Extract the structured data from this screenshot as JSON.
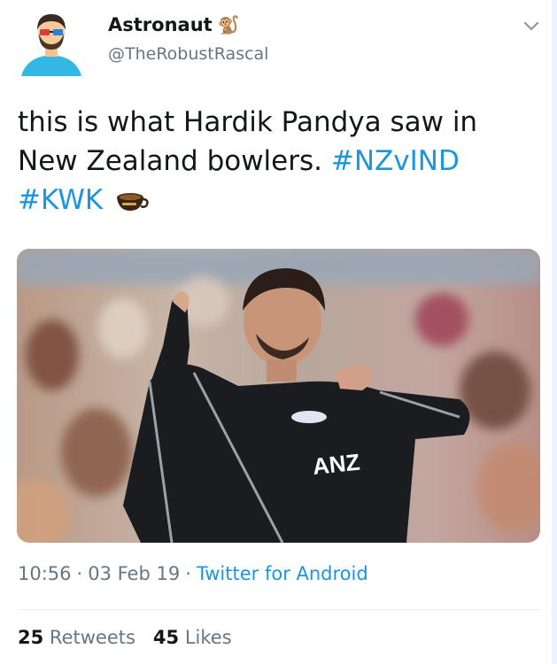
{
  "tweet": {
    "author": {
      "name": "Astronaut",
      "name_emoji": "🐒",
      "handle": "@TheRobustRascal"
    },
    "text": {
      "line1": "this is what Hardik Pandya saw in",
      "line2": "New Zealand bowlers.",
      "hashtag1": "#NZvIND",
      "hashtag2": "#KWK"
    },
    "media": {
      "jersey_text": "ANZ"
    },
    "meta": {
      "time": "10:56",
      "sep1": "·",
      "date": "03 Feb 19",
      "sep2": "·",
      "source": "Twitter for Android"
    },
    "stats": {
      "retweets_count": "25",
      "retweets_label": "Retweets",
      "likes_count": "45",
      "likes_label": "Likes"
    }
  },
  "colors": {
    "link": "#1b95e0",
    "secondary_text": "#657786",
    "primary_text": "#14171a"
  },
  "icons": [
    "avatar",
    "monkey-emoji",
    "chevron-down-icon",
    "coffee-icon"
  ]
}
